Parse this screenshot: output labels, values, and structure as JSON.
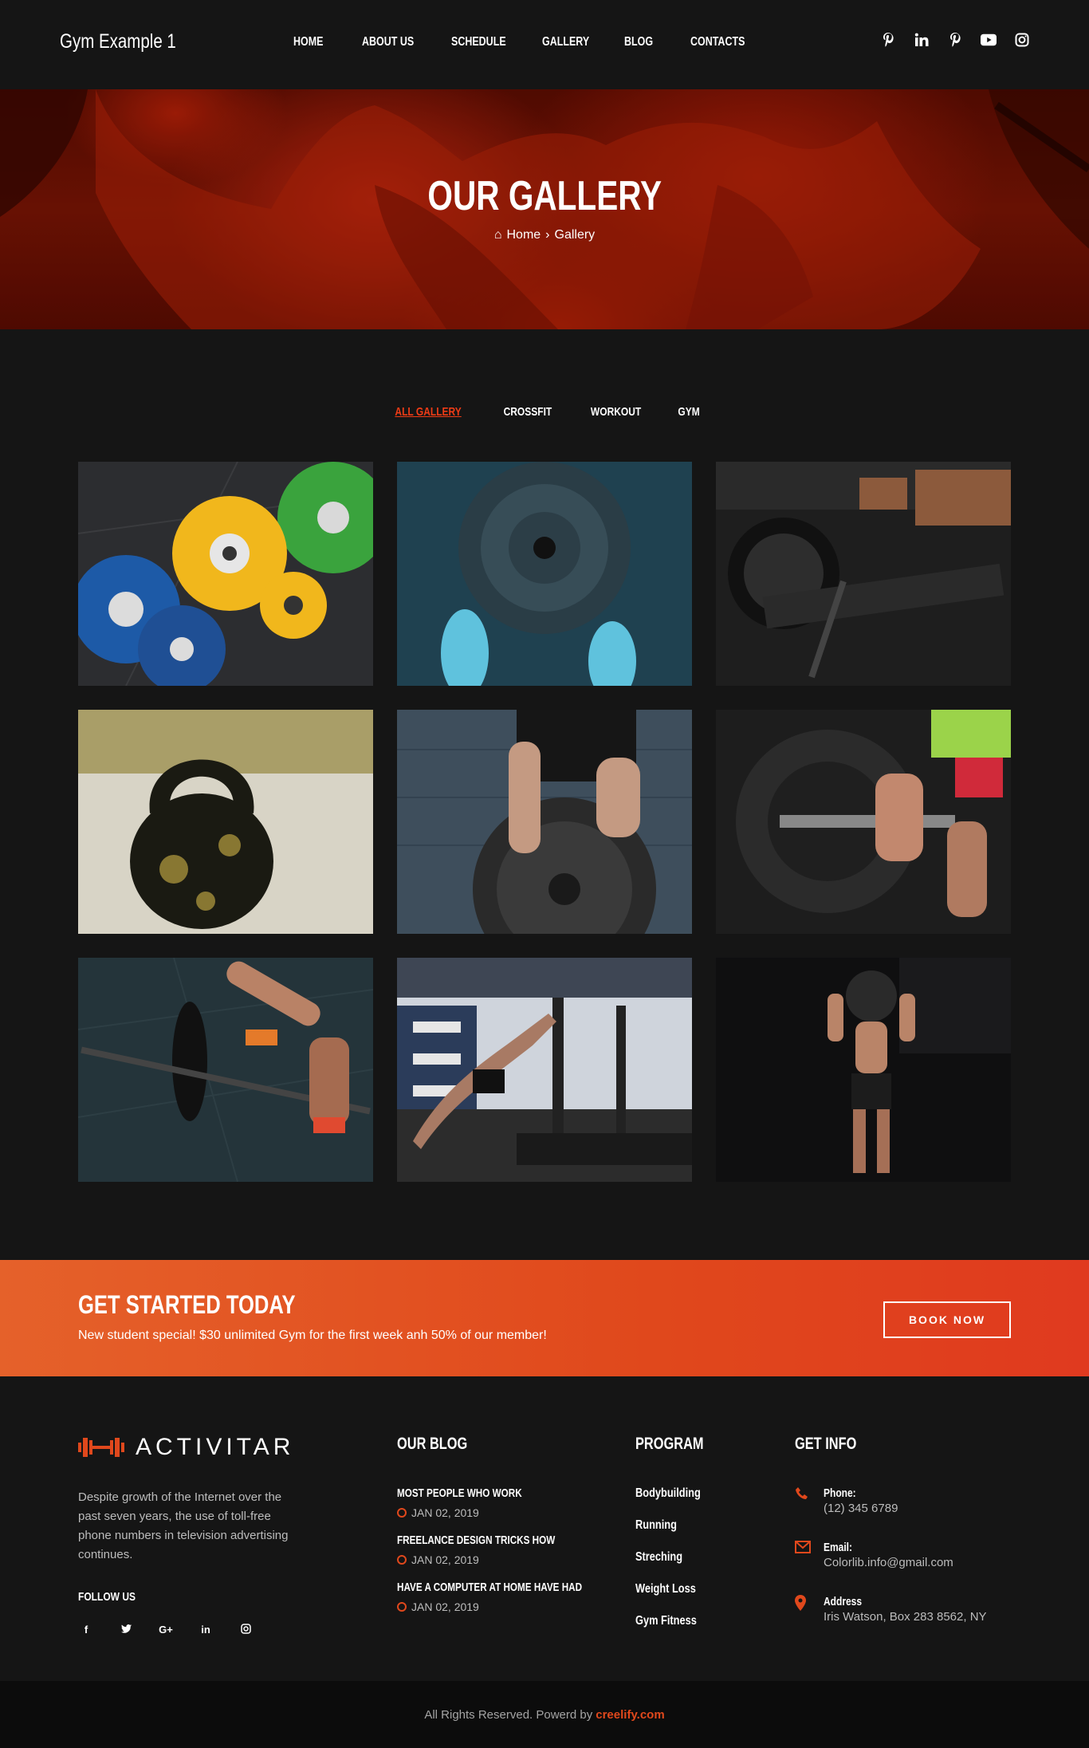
{
  "header": {
    "brand": "Gym Example 1",
    "nav": [
      "HOME",
      "ABOUT US",
      "SCHEDULE",
      "GALLERY",
      "BLOG",
      "CONTACTS"
    ],
    "social": [
      "pinterest-icon",
      "linkedin-icon",
      "pinterest-icon",
      "youtube-icon",
      "instagram-icon"
    ]
  },
  "hero": {
    "title": "OUR GALLERY",
    "breadcrumb_home": "Home",
    "breadcrumb_current": "Gallery"
  },
  "filters": [
    "ALL GALLERY",
    "CROSSFIT",
    "WORKOUT",
    "GYM"
  ],
  "gallery": [
    {
      "alt": "bumper-plates"
    },
    {
      "alt": "rogue-plate-shoes"
    },
    {
      "alt": "rowing-machine"
    },
    {
      "alt": "kettlebell"
    },
    {
      "alt": "york-plate"
    },
    {
      "alt": "barbell-lift"
    },
    {
      "alt": "deadlift-barbell"
    },
    {
      "alt": "sled-push"
    },
    {
      "alt": "medicine-ball"
    }
  ],
  "cta": {
    "title": "GET STARTED TODAY",
    "text": "New student special! $30 unlimited Gym for the first week anh 50% of our member!",
    "button": "BOOK NOW"
  },
  "footer": {
    "logo_text": "ACTIVITAR",
    "description": "Despite growth of the Internet over the past seven years, the use of toll-free phone numbers in television advertising continues.",
    "follow_title": "FOLLOW US",
    "follow_icons": [
      "facebook-icon",
      "twitter-icon",
      "google-plus-icon",
      "linkedin-icon",
      "instagram-icon"
    ],
    "blog_title": "OUR BLOG",
    "blog": [
      {
        "title": "MOST PEOPLE WHO WORK",
        "date": "JAN 02, 2019"
      },
      {
        "title": "FREELANCE DESIGN TRICKS HOW",
        "date": "JAN 02, 2019"
      },
      {
        "title": "HAVE A COMPUTER AT HOME HAVE HAD",
        "date": "JAN 02, 2019"
      }
    ],
    "program_title": "PROGRAM",
    "program": [
      "Bodybuilding",
      "Running",
      "Streching",
      "Weight Loss",
      "Gym Fitness"
    ],
    "info_title": "GET INFO",
    "info": [
      {
        "label": "Phone:",
        "value": "(12) 345 6789"
      },
      {
        "label": "Email:",
        "value": "Colorlib.info@gmail.com"
      },
      {
        "label": "Address",
        "value": "Iris Watson, Box 283 8562, NY"
      }
    ]
  },
  "copyright": {
    "text": "All Rights Reserved. Powerd by",
    "link": "creelify.com"
  },
  "colors": {
    "accent": "#e0481c",
    "bg": "#151515"
  }
}
